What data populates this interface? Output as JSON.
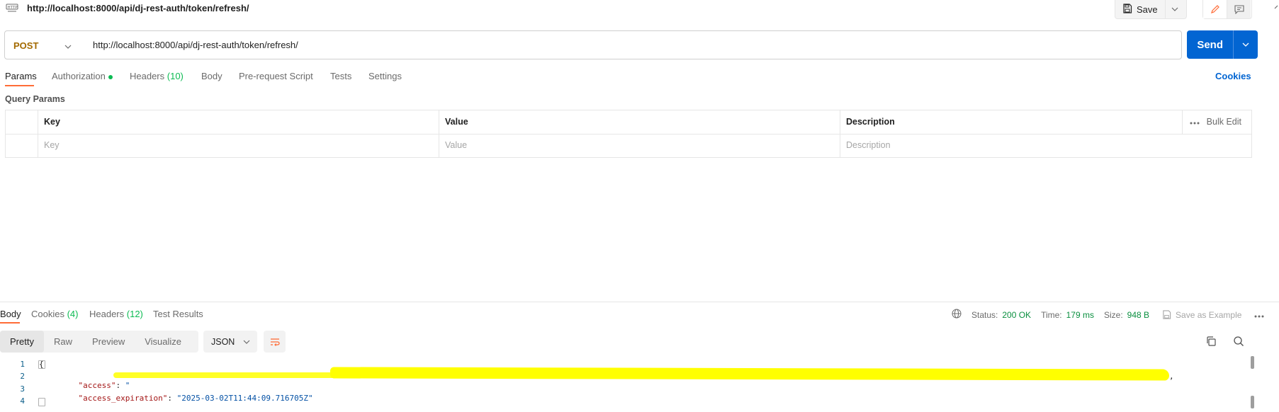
{
  "request_title": "http://localhost:8000/api/dj-rest-auth/token/refresh/",
  "toolbar": {
    "save_label": "Save"
  },
  "request": {
    "method": "POST",
    "url": "http://localhost:8000/api/dj-rest-auth/token/refresh/",
    "send_label": "Send"
  },
  "request_tabs": {
    "params": "Params",
    "authorization": "Authorization",
    "headers": "Headers",
    "headers_count": "(10)",
    "body": "Body",
    "prerequest": "Pre-request Script",
    "tests": "Tests",
    "settings": "Settings",
    "cookies": "Cookies"
  },
  "query_params": {
    "label": "Query Params",
    "headers": {
      "key": "Key",
      "value": "Value",
      "description": "Description"
    },
    "bulk_edit": "Bulk Edit",
    "placeholders": {
      "key": "Key",
      "value": "Value",
      "description": "Description"
    }
  },
  "response": {
    "tabs": {
      "body": "Body",
      "cookies": "Cookies",
      "cookies_count": "(4)",
      "headers": "Headers",
      "headers_count": "(12)",
      "test_results": "Test Results"
    },
    "status_label": "Status:",
    "status_value": "200 OK",
    "time_label": "Time:",
    "time_value": "179 ms",
    "size_label": "Size:",
    "size_value": "948 B",
    "save_example": "Save as Example",
    "format_tabs": {
      "pretty": "Pretty",
      "raw": "Raw",
      "preview": "Preview",
      "visualize": "Visualize"
    },
    "format": "JSON",
    "code": {
      "line_numbers": [
        "1",
        "2",
        "3",
        "4"
      ],
      "open_brace": "{",
      "access_key": "\"access\"",
      "access_value_start": "\"",
      "access_expiration_key": "\"access_expiration\"",
      "access_expiration_value": "\"2025-03-02T11:44:09.716705Z\"",
      "colon": ": ",
      "comma": ","
    }
  },
  "colors": {
    "accent": "#ff6c37",
    "send": "#0265d2",
    "method": "#a36a00",
    "status_ok": "#0a8f3f",
    "redaction": "#ffff00"
  }
}
